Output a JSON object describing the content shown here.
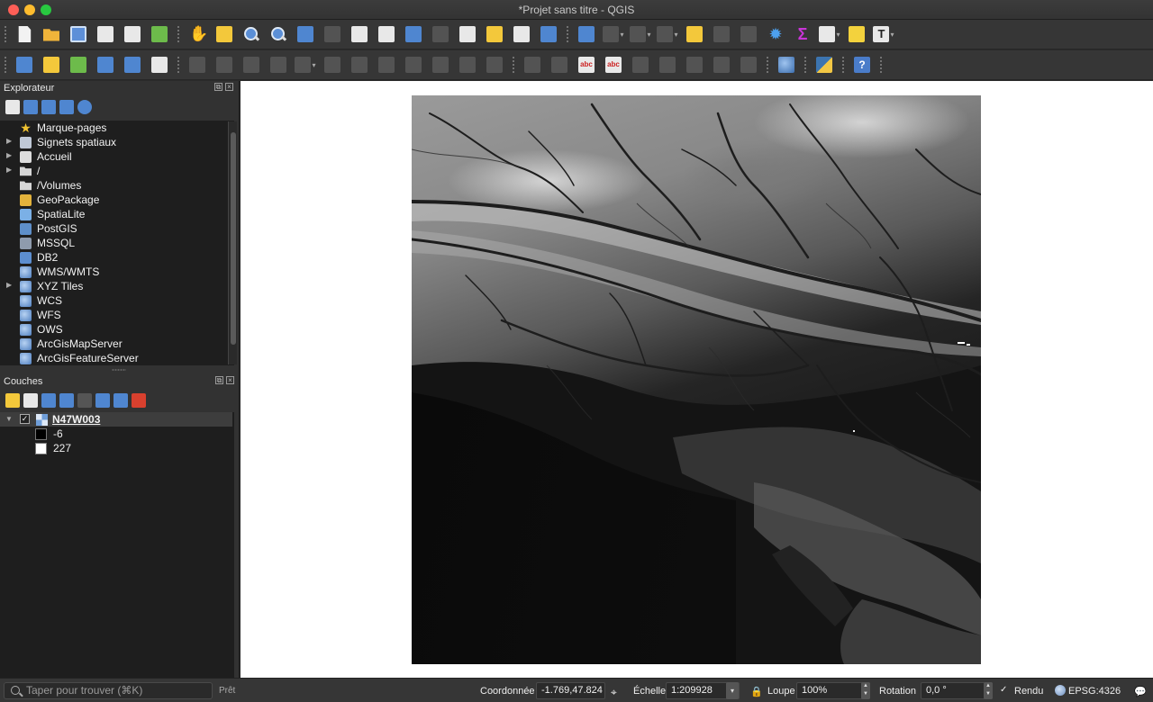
{
  "window": {
    "title": "*Projet sans titre - QGIS"
  },
  "explorer": {
    "title": "Explorateur",
    "items": [
      {
        "label": "Marque-pages",
        "icon": "star-icon",
        "expandable": false
      },
      {
        "label": "Signets spatiaux",
        "icon": "bookmark-icon",
        "expandable": true
      },
      {
        "label": "Accueil",
        "icon": "home-icon",
        "expandable": true
      },
      {
        "label": "/",
        "icon": "folder-icon",
        "expandable": true
      },
      {
        "label": "/Volumes",
        "icon": "folder-icon",
        "expandable": false
      },
      {
        "label": "GeoPackage",
        "icon": "geopackage-icon",
        "expandable": false
      },
      {
        "label": "SpatiaLite",
        "icon": "spatialite-icon",
        "expandable": false
      },
      {
        "label": "PostGIS",
        "icon": "postgis-icon",
        "expandable": false
      },
      {
        "label": "MSSQL",
        "icon": "mssql-icon",
        "expandable": false
      },
      {
        "label": "DB2",
        "icon": "db2-icon",
        "expandable": false
      },
      {
        "label": "WMS/WMTS",
        "icon": "globe-icon",
        "expandable": false
      },
      {
        "label": "XYZ Tiles",
        "icon": "globe-icon",
        "expandable": true
      },
      {
        "label": "WCS",
        "icon": "globe-icon",
        "expandable": false
      },
      {
        "label": "WFS",
        "icon": "globe-icon",
        "expandable": false
      },
      {
        "label": "OWS",
        "icon": "globe-icon",
        "expandable": false
      },
      {
        "label": "ArcGisMapServer",
        "icon": "globe-icon",
        "expandable": false
      },
      {
        "label": "ArcGisFeatureServer",
        "icon": "globe-icon",
        "expandable": false
      }
    ]
  },
  "layers": {
    "title": "Couches",
    "layer_name": "N47W003",
    "legend": [
      {
        "label": "-6",
        "color": "#000000"
      },
      {
        "label": "227",
        "color": "#ffffff"
      }
    ]
  },
  "statusbar": {
    "search_placeholder": "Taper pour trouver (⌘K)",
    "message": "Prêt",
    "coord_label": "Coordonnée",
    "coord_value": "-1.769,47.824",
    "scale_label": "Échelle",
    "scale_value": "1:209928",
    "magnifier_label": "Loupe",
    "magnifier_value": "100%",
    "rotation_label": "Rotation",
    "rotation_value": "0,0 °",
    "render_label": "Rendu",
    "crs_label": "EPSG:4326"
  }
}
